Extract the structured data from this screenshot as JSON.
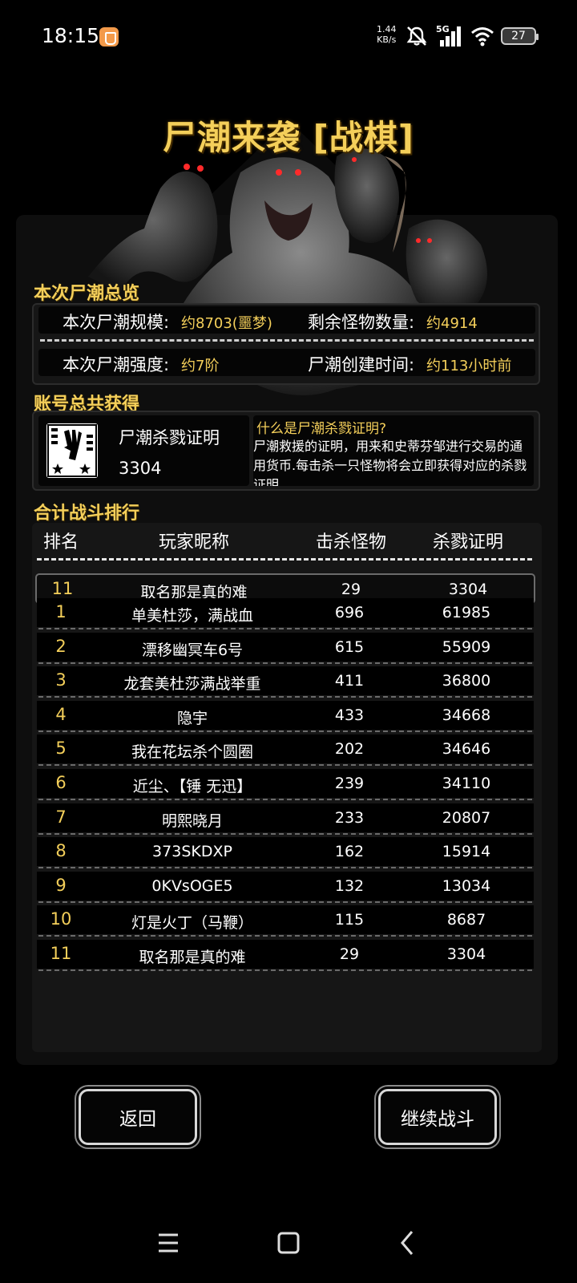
{
  "status_bar": {
    "time": "18:15",
    "net_speed_value": "1.44",
    "net_speed_unit": "KB/s",
    "network": "5G",
    "battery": "27"
  },
  "title": "尸潮来袭 [战棋]",
  "overview": {
    "section_title": "本次尸潮总览",
    "scale_label": "本次尸潮规模:",
    "scale_value": "约8703(噩梦)",
    "remaining_label": "剩余怪物数量:",
    "remaining_value": "约4914",
    "strength_label": "本次尸潮强度:",
    "strength_value": "约7阶",
    "created_label": "尸潮创建时间:",
    "created_value": "约113小时前"
  },
  "account": {
    "section_title": "账号总共获得",
    "cert_name": "尸潮杀戮证明",
    "cert_value": "3304",
    "info_question": "什么是尸潮杀戮证明?",
    "info_answer": "尸潮救援的证明，用来和史蒂芬邹进行交易的通用货币.每击杀一只怪物将会立即获得对应的杀戮证明."
  },
  "ranking": {
    "section_title": "合计战斗排行",
    "headers": {
      "rank": "排名",
      "name": "玩家昵称",
      "kills": "击杀怪物",
      "certs": "杀戮证明"
    },
    "self_row": {
      "rank": "11",
      "name": "取名那是真的难",
      "kills": "29",
      "certs": "3304"
    },
    "rows": [
      {
        "rank": "1",
        "name": "单美杜莎，满战血",
        "kills": "696",
        "certs": "61985"
      },
      {
        "rank": "2",
        "name": "漂移幽冥车6号",
        "kills": "615",
        "certs": "55909"
      },
      {
        "rank": "3",
        "name": "龙套美杜莎满战举重",
        "kills": "411",
        "certs": "36800"
      },
      {
        "rank": "4",
        "name": "隐宇",
        "kills": "433",
        "certs": "34668"
      },
      {
        "rank": "5",
        "name": "我在花坛杀个圆圈",
        "kills": "202",
        "certs": "34646"
      },
      {
        "rank": "6",
        "name": "近尘、【锤 无迅】",
        "kills": "239",
        "certs": "34110"
      },
      {
        "rank": "7",
        "name": "明熙晓月",
        "kills": "233",
        "certs": "20807"
      },
      {
        "rank": "8",
        "name": "373SKDXP",
        "kills": "162",
        "certs": "15914"
      },
      {
        "rank": "9",
        "name": "0KVsOGE5",
        "kills": "132",
        "certs": "13034"
      },
      {
        "rank": "10",
        "name": "灯是火丁（马鞭）",
        "kills": "115",
        "certs": "8687"
      },
      {
        "rank": "11",
        "name": "取名那是真的难",
        "kills": "29",
        "certs": "3304"
      }
    ]
  },
  "buttons": {
    "back": "返回",
    "continue": "继续战斗"
  },
  "colors": {
    "accent_gold": "#f4cf5a",
    "panel": "#161616",
    "background": "#000000"
  },
  "icons": [
    "app-badge-icon",
    "mute-icon",
    "signal-icon",
    "wifi-icon",
    "battery-icon",
    "certificate-icon",
    "menu-icon",
    "home-icon",
    "back-icon"
  ]
}
